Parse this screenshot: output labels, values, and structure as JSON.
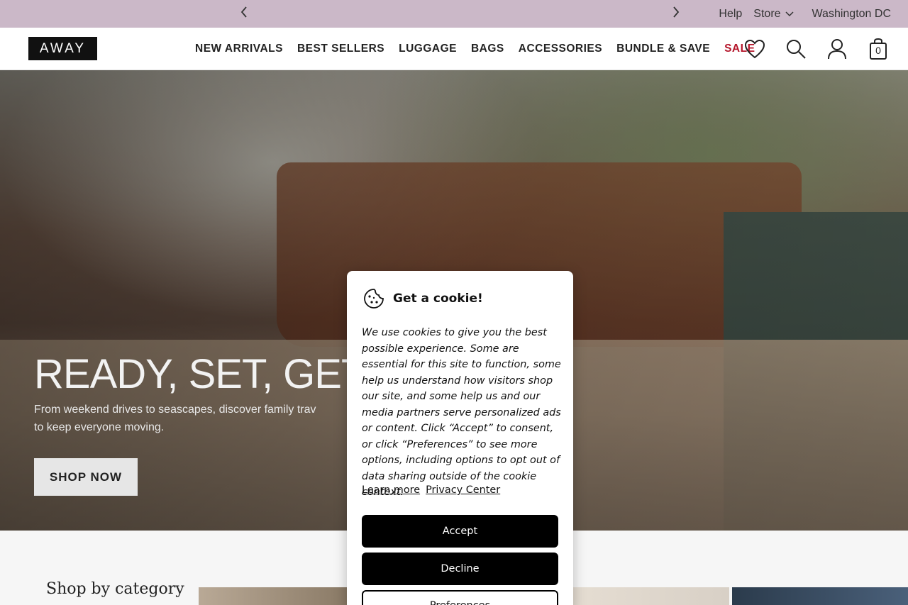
{
  "promo_bar": {
    "prev_icon": "chevron-left-icon",
    "next_icon": "chevron-right-icon",
    "help": "Help",
    "store": "Store",
    "location": "Washington DC"
  },
  "header": {
    "logo": "AWAY",
    "nav": [
      "NEW ARRIVALS",
      "BEST SELLERS",
      "LUGGAGE",
      "BAGS",
      "ACCESSORIES",
      "BUNDLE & SAVE",
      "SALE"
    ],
    "sale_color": "#b5162b",
    "cart_count": "0"
  },
  "hero": {
    "title": "READY, SET, GET A",
    "subtitle": "From weekend drives to seascapes, discover family trav",
    "subtitle_line2": "to keep everyone moving.",
    "cta": "SHOP NOW"
  },
  "below": {
    "section_title": "Shop by category"
  },
  "cookie": {
    "icon": "cookie-icon",
    "title": "Get a cookie!",
    "body": "We use cookies to give you the best possible experience. Some are essential for this site to function, some help us understand how visitors shop our site, and some help us and our media partners serve personalized ads or content. Click “Accept” to consent, or click “Preferences” to see more options, including options to opt out of data sharing outside of the cookie context.",
    "learn_more": "Learn more",
    "privacy_center": "Privacy Center",
    "accept": "Accept",
    "decline": "Decline",
    "preferences": "Preferences"
  }
}
